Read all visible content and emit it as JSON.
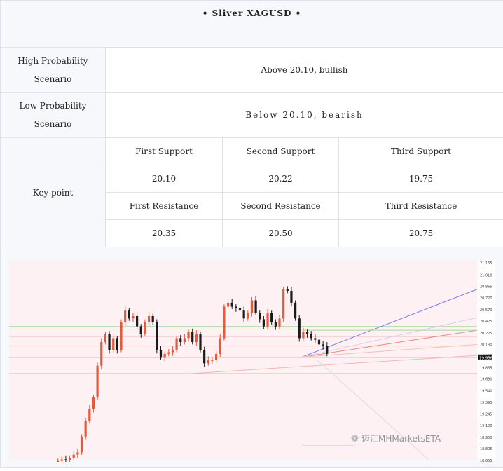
{
  "title": "•  Sliver XAGUSD   •",
  "high_probability": {
    "label_line1": "High Probability",
    "label_line2": "Scenario",
    "value": "Above 20.10, bullish"
  },
  "low_probability": {
    "label_line1": "Low Probability",
    "label_line2": "Scenario",
    "value": "Below  20.10,  bearish"
  },
  "key_point": {
    "label": "Key point",
    "support_headers": [
      "First Support",
      "Second Support",
      "Third Support"
    ],
    "support_values": [
      "20.10",
      "20.22",
      "19.75"
    ],
    "resistance_headers": [
      "First Resistance",
      "Second Resistance",
      "Third Resistance"
    ],
    "resistance_values": [
      "20.35",
      "20.50",
      "20.75"
    ]
  },
  "watermark": "迈汇MHMarketsETA",
  "colors": {
    "bull_candle": "#e8593a",
    "bear_candle": "#1a1a1a",
    "chart_bg": "#fdf1f3",
    "price_tag": "#1a1a1a"
  },
  "chart_data": {
    "type": "candlestick",
    "price_tag": "19.956",
    "y_ticks": [
      "21.165",
      "21.010",
      "20.865",
      "20.720",
      "20.570",
      "20.425",
      "20.275",
      "20.130",
      "19.985",
      "19.835",
      "19.690",
      "19.540",
      "19.395",
      "19.245",
      "19.100",
      "18.950",
      "18.805",
      "18.655"
    ],
    "ylim": [
      18.655,
      21.165
    ],
    "closes": [
      18.64,
      18.66,
      18.65,
      18.68,
      18.72,
      18.75,
      18.95,
      19.15,
      19.3,
      19.45,
      19.85,
      20.15,
      20.25,
      20.05,
      20.2,
      20.05,
      20.4,
      20.55,
      20.45,
      20.48,
      20.35,
      20.25,
      20.4,
      20.48,
      20.4,
      20.05,
      19.95,
      20.0,
      20.02,
      20.05,
      20.2,
      20.15,
      20.2,
      20.28,
      20.15,
      20.25,
      20.05,
      19.88,
      19.92,
      19.92,
      20.0,
      20.2,
      20.6,
      20.65,
      20.6,
      20.58,
      20.55,
      20.45,
      20.52,
      20.68,
      20.52,
      20.44,
      20.35,
      20.52,
      20.4,
      20.35,
      20.45,
      20.82,
      20.8,
      20.65,
      20.45,
      20.2,
      20.28,
      20.25,
      20.2,
      20.18,
      20.12,
      20.1,
      20.0
    ],
    "horizontal_levels": [
      20.35,
      20.1,
      20.22,
      19.75,
      19.956
    ]
  }
}
